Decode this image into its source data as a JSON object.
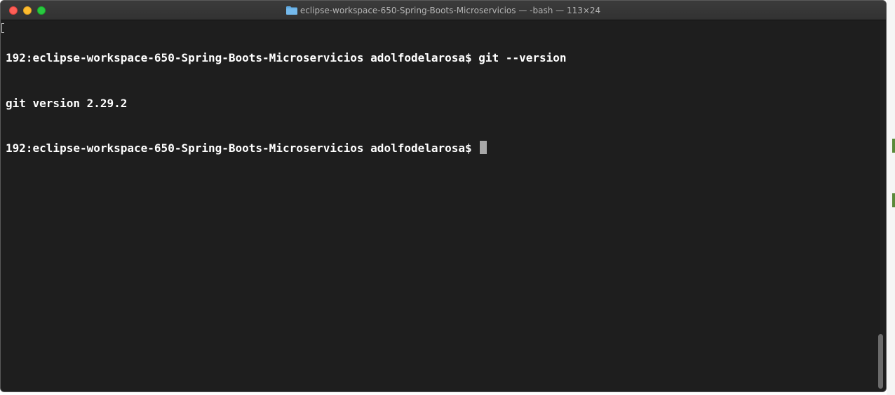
{
  "window": {
    "title": "eclipse-workspace-650-Spring-Boots-Microservicios — -bash — 113×24",
    "folder_icon": "folder-icon"
  },
  "terminal": {
    "lines": [
      "192:eclipse-workspace-650-Spring-Boots-Microservicios adolfodelarosa$ git --version",
      "git version 2.29.2",
      "192:eclipse-workspace-650-Spring-Boots-Microservicios adolfodelarosa$ "
    ]
  },
  "colors": {
    "terminal_bg": "#1e1e1e",
    "terminal_fg": "#ffffff",
    "cursor": "#a8a8a8",
    "close": "#fe5f57",
    "minimize": "#febc2e",
    "maximize": "#28c840"
  }
}
